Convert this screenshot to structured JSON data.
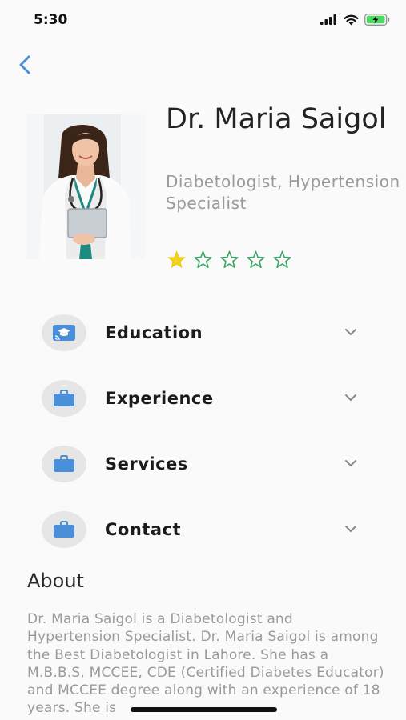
{
  "status_bar": {
    "time": "5:30"
  },
  "doctor": {
    "name": "Dr. Maria Saigol",
    "specialty": "Diabetologist, Hypertension Specialist",
    "rating": 1,
    "rating_max": 5
  },
  "sections": [
    {
      "label": "Education",
      "icon": "education-icon"
    },
    {
      "label": "Experience",
      "icon": "briefcase-icon"
    },
    {
      "label": "Services",
      "icon": "briefcase-icon"
    },
    {
      "label": "Contact",
      "icon": "briefcase-icon"
    }
  ],
  "about": {
    "title": "About",
    "text": "Dr. Maria Saigol is a Diabetologist and Hypertension Specialist. Dr. Maria Saigol is among the Best Diabetologist in Lahore. She has a M.B.B.S, MCCEE, CDE (Certified Diabetes Educator) and MCCEE degree along with an experience of 18 years. She is"
  },
  "colors": {
    "accent_blue": "#4a8fd8",
    "star_filled": "#f2d21a",
    "star_outline": "#3aa563"
  }
}
